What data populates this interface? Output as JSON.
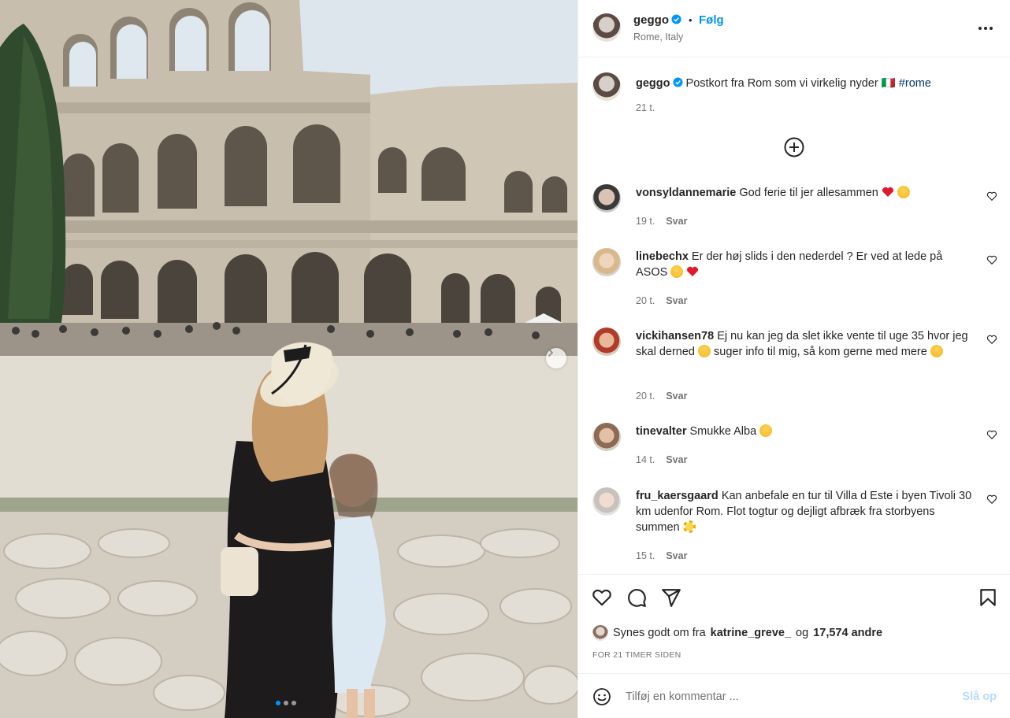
{
  "post": {
    "username": "geggo",
    "follow_label": "Følg",
    "dot": "•",
    "location": "Rome, Italy",
    "caption_user": "geggo",
    "caption_text": "Postkort fra Rom som vi virkelig nyder 🇮🇹",
    "caption_hashtag": "#rome",
    "caption_time": "21 t."
  },
  "comments": [
    {
      "user": "vonsyldannemarie",
      "text": "God ferie til jer allesammen",
      "emojis": [
        "red-heart",
        "star-struck"
      ],
      "time": "19 t.",
      "reply": "Svar"
    },
    {
      "user": "linebechx",
      "text": "Er der høj slids i den nederdel ? Er ved at lede på ASOS",
      "emojis": [
        "grinning",
        "red-heart"
      ],
      "time": "20 t.",
      "reply": "Svar"
    },
    {
      "user": "vickihansen78",
      "text_before": "Ej nu kan jeg da slet ikke vente til uge 35 hvor jeg skal derned",
      "text_after": "suger info til mig, så kom gerne med mere",
      "emojis": [
        "star-struck",
        "grinning"
      ],
      "time": "20 t.",
      "reply": "Svar"
    },
    {
      "user": "tinevalter",
      "text": "Smukke Alba",
      "emojis": [
        "star-struck"
      ],
      "time": "14 t.",
      "reply": "Svar"
    },
    {
      "user": "fru_kaersgaard",
      "text": "Kan anbefale en tur til Villa d Este i byen Tivoli 30 km udenfor Rom. Flot togtur og dejligt afbræk fra storbyens summen",
      "emojis": [
        "sun"
      ],
      "time": "15 t.",
      "reply": "Svar"
    }
  ],
  "likes": {
    "prefix": "Synes godt om fra",
    "liker": "katrine_greve_",
    "joiner": "og",
    "count": "17,574 andre"
  },
  "timestamp": "FOR 21 TIMER SIDEN",
  "composer": {
    "placeholder": "Tilføj en kommentar ...",
    "post_label": "Slå op"
  },
  "carousel": {
    "total": 3,
    "active": 1
  },
  "colors": {
    "accent": "#0095f6",
    "muted": "#737373",
    "hashtag": "#00376b",
    "post_disabled": "#b3dbff"
  }
}
